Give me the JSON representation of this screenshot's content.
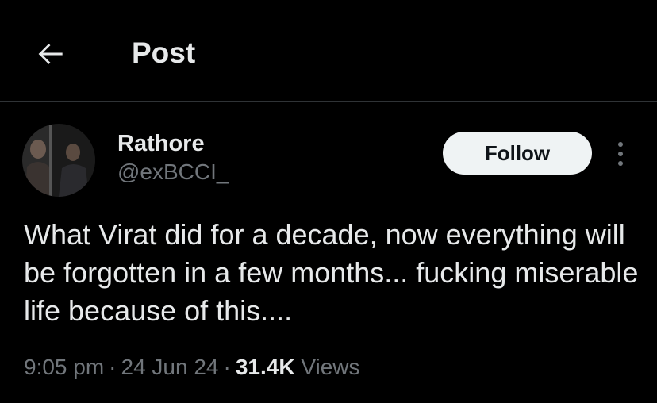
{
  "header": {
    "back_icon": "arrow-left-icon",
    "title": "Post"
  },
  "post": {
    "author": {
      "display_name": "Rathore",
      "handle": "@exBCCI_",
      "avatar_icon": "profile-photo"
    },
    "follow_label": "Follow",
    "more_icon": "more-vertical-icon",
    "text": "What Virat did for a decade, now everything will be forgotten in a few months... fucking miserable life because of this....",
    "time": "9:05 pm",
    "separator": "·",
    "date": "24 Jun 24",
    "views_count": "31.4K",
    "views_label": "Views"
  },
  "colors": {
    "background": "#000000",
    "text_primary": "#e7e9ea",
    "text_secondary": "#71767b",
    "divider": "#2f3336",
    "button_bg": "#eff3f4",
    "button_text": "#0f1419"
  }
}
